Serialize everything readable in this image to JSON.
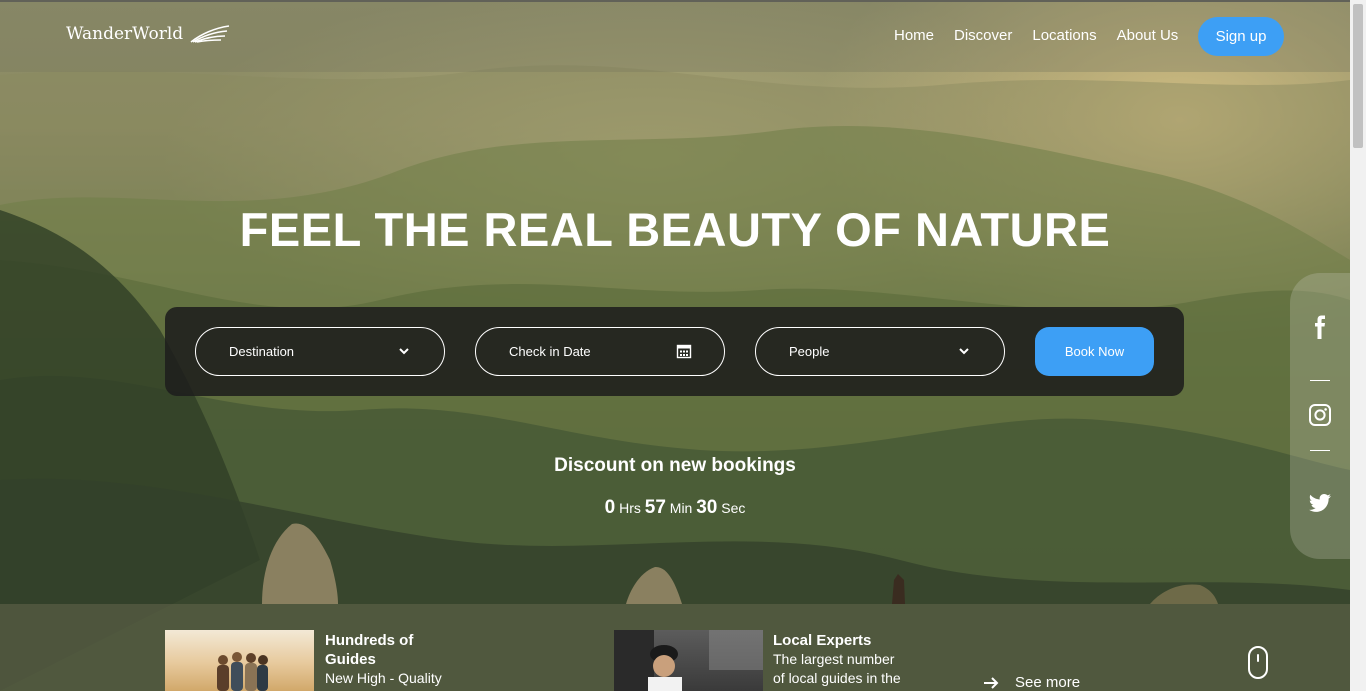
{
  "brand": {
    "name": "WanderWorld",
    "logo_icon": "wing-icon"
  },
  "nav": {
    "links": [
      {
        "label": "Home"
      },
      {
        "label": "Discover"
      },
      {
        "label": "Locations"
      },
      {
        "label": "About Us"
      }
    ],
    "signup_label": "Sign up"
  },
  "hero": {
    "title": "FEEL THE REAL BEAUTY OF NATURE"
  },
  "booking": {
    "destination_label": "Destination",
    "checkin_label": "Check in Date",
    "people_label": "People",
    "book_label": "Book Now"
  },
  "discount": {
    "title": "Discount on new bookings",
    "hours": "0",
    "hours_unit": "Hrs",
    "minutes": "57",
    "minutes_unit": "Min",
    "seconds": "30",
    "seconds_unit": "Sec"
  },
  "social": {
    "icons": [
      "facebook-icon",
      "instagram-icon",
      "twitter-icon"
    ]
  },
  "features": [
    {
      "title": "Hundreds of Guides",
      "title_line1": "Hundreds of",
      "title_line2": "Guides",
      "desc": "New High - Quality"
    },
    {
      "title": "Local Experts",
      "desc_line1": "The largest number",
      "desc_line2": "of local guides in the"
    }
  ],
  "see_more_label": "See more",
  "colors": {
    "accent": "#3d9ff5",
    "booking_bg": "#1e1e1c"
  }
}
